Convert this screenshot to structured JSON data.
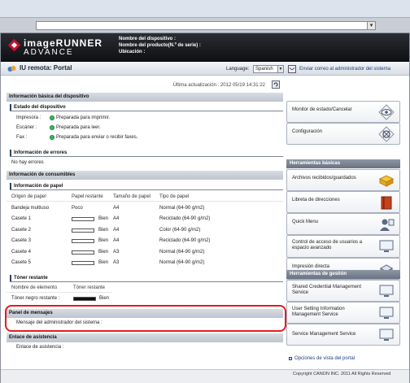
{
  "header": {
    "logo_line1": "imageRUNNER",
    "logo_line2": "ADVANCE",
    "device_name_label": "Nombre del dispositivo :",
    "product_name_label": "Nombre del producto(N.º de serie) :",
    "location_label": "Ubicación :"
  },
  "subbar": {
    "title": "IU remota: Portal",
    "language_label": "Language:",
    "language_value": "Spanish",
    "mail_link": "Enviar correo al administrador del sistema"
  },
  "main": {
    "last_update": "Última actualización : 2012 05/19 14:31:22",
    "basic_info_title": "Información básica del dispositivo",
    "device_status_title": "Estado del dispositivo",
    "status_rows": [
      {
        "label": "Impresora :",
        "value": "Preparada para imprimir."
      },
      {
        "label": "Escáner :",
        "value": "Preparada para leer."
      },
      {
        "label": "Fax :",
        "value": "Preparada para enviar o recibir faxes."
      }
    ],
    "error_info_title": "Información de errores",
    "no_errors": "No hay errores",
    "consumables_title": "Información de consumibles",
    "paper_info_title": "Información de papel",
    "paper_headers": [
      "Origen de papel",
      "Papel restante",
      "Tamaño de papel",
      "Tipo de papel"
    ],
    "paper_rows": [
      {
        "source": "Bandeja multiuso",
        "remaining": "Poco",
        "bar": null,
        "size": "A4",
        "type": "Normal (64-90 g/m2)"
      },
      {
        "source": "Casete 1",
        "remaining": "Bien",
        "bar": 0,
        "size": "A4",
        "type": "Reciclado (64-90 g/m2)"
      },
      {
        "source": "Casete 2",
        "remaining": "Bien",
        "bar": 0,
        "size": "A4",
        "type": "Color (64-90 g/m2)"
      },
      {
        "source": "Casete 3",
        "remaining": "Bien",
        "bar": 0,
        "size": "A4",
        "type": "Reciclado (64-90 g/m2)"
      },
      {
        "source": "Casete 4",
        "remaining": "Bien",
        "bar": 0,
        "size": "A3",
        "type": "Normal (64-90 g/m2)"
      },
      {
        "source": "Casete 5",
        "remaining": "Bien",
        "bar": 0,
        "size": "A3",
        "type": "Normal (64-90 g/m2)"
      }
    ],
    "toner_title": "Tóner restante",
    "toner_headers": [
      "Nombre de elemento",
      "Tóner restante"
    ],
    "toner_row": {
      "name": "Tóner negro restante :",
      "level": 1,
      "status": "Bien"
    },
    "message_panel_title": "Panel de mensajes",
    "message_admin": "Mensaje del administrador del sistema :",
    "support_title": "Enlace de asistencia",
    "support_link": "Enlace de asistencia :"
  },
  "right": {
    "top_buttons": [
      "Monitor de estado/Cancelar",
      "Configuración"
    ],
    "basic_tools_title": "Herramientas básicas",
    "basic_tools": [
      "Archivos recibidos/guardados",
      "Libreta de direcciones",
      "Quick Menu",
      "Control de acceso de usuarios a espacio avanzado",
      "Impresión directa"
    ],
    "mgmt_tools_title": "Herramientas de gestión",
    "mgmt_tools": [
      "Shared Credential Management Service",
      "User Setting Information Management Service",
      "Service Management Service"
    ],
    "view_options": "Opciones de vista del portal"
  },
  "footer": {
    "copyright": "Copyright CANON INC. 2011 All Rights Reserved"
  }
}
